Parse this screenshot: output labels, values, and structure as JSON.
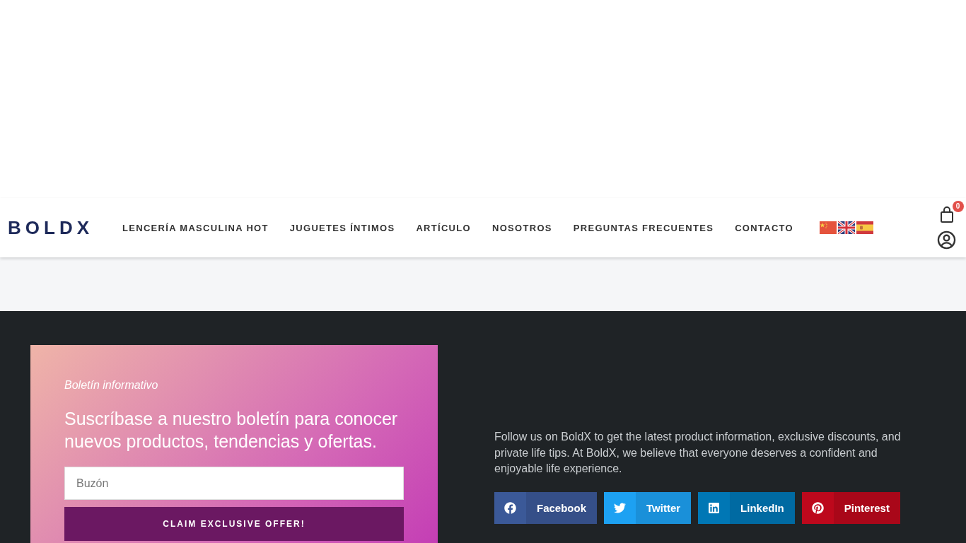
{
  "header": {
    "logo": "BOLDX",
    "nav": [
      {
        "label": "LENCERÍA MASCULINA HOT"
      },
      {
        "label": "JUGUETES ÍNTIMOS"
      },
      {
        "label": "ARTÍCULO"
      },
      {
        "label": "NOSOTROS"
      },
      {
        "label": "PREGUNTAS FRECUENTES"
      },
      {
        "label": "CONTACTO"
      }
    ],
    "flags": [
      {
        "kind": "cn"
      },
      {
        "kind": "gb"
      },
      {
        "kind": "es"
      }
    ],
    "cart_count": "0"
  },
  "newsletter": {
    "eyebrow": "Boletín informativo",
    "heading": "Suscríbase a nuestro boletín para conocer nuevos productos, tendencias y ofertas.",
    "email": {
      "placeholder": "Buzón"
    },
    "button": "CLAIM EXCLUSIVE OFFER!"
  },
  "about": {
    "text": "Follow us on BoldX to get the latest product information, exclusive discounts, and private life tips. At BoldX, we believe that everyone deserves a confident and enjoyable life experience.",
    "share": [
      {
        "kind": "facebook",
        "label": "Facebook",
        "color": "#3b5998"
      },
      {
        "kind": "twitter",
        "label": "Twitter",
        "color": "#1da1f2"
      },
      {
        "kind": "linkedin",
        "label": "LinkedIn",
        "color": "#0077b5"
      },
      {
        "kind": "pinterest",
        "label": "Pinterest",
        "color": "#bd081c"
      }
    ]
  }
}
